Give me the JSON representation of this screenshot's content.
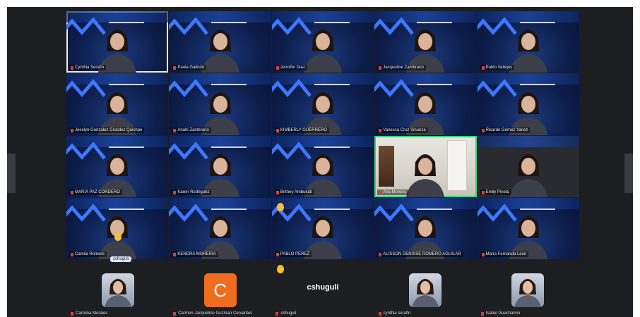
{
  "participants": [
    {
      "name": "Cynthia Serafin",
      "style": "first"
    },
    {
      "name": "Paola Galindo"
    },
    {
      "name": "Jennifer Diaz"
    },
    {
      "name": "Jacqueline Zambrano"
    },
    {
      "name": "Pablo Vallejos"
    },
    {
      "name": "Jocelyn Gonzalez Giraldez Quishpe"
    },
    {
      "name": "Anahi Zambrano"
    },
    {
      "name": "KIMBERLY GUERRERO"
    },
    {
      "name": "Vanessa Cruz Vinueza"
    },
    {
      "name": "Ricardo Gómez Yanez"
    },
    {
      "name": "MARIA PAZ CORDERO"
    },
    {
      "name": "Karen Rodriguez"
    },
    {
      "name": "Britney Ambuludi"
    },
    {
      "name": "Ana Moreno",
      "style": "video"
    },
    {
      "name": "Emily Pinela",
      "style": "darkbg"
    },
    {
      "name": "Camila Romero"
    },
    {
      "name": "KENDRA MOREIRA"
    },
    {
      "name": "PABLO PEREZ"
    },
    {
      "name": "ALISSON DENISSE ROMERO AGUILAR"
    },
    {
      "name": "María Fernanda Leon"
    }
  ],
  "caption_tag": "cshuguli",
  "strip": [
    {
      "name": "Carolina Morales",
      "type": "photo"
    },
    {
      "name": "Carmen Jacqueline Guzman Cervantes",
      "type": "letter",
      "letter": "C"
    },
    {
      "name": "cshuguli",
      "type": "text",
      "label": "cshuguli"
    },
    {
      "name": "cynthia serafin",
      "type": "photo"
    },
    {
      "name": "Isabel Guachamin",
      "type": "photo"
    }
  ],
  "colors": {
    "accent_border": "#3bd47c",
    "avatar_orange": "#ee6d1f",
    "name_flag": "#e23b3b"
  }
}
